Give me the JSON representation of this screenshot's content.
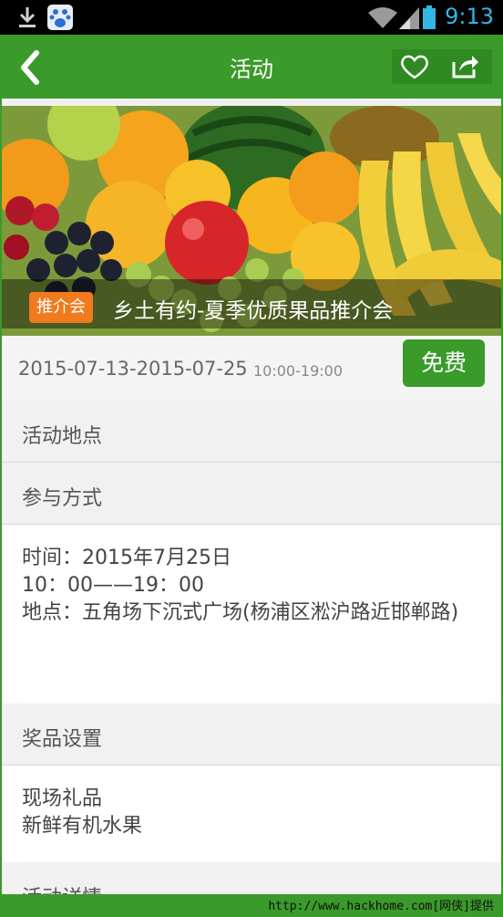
{
  "status_bar": {
    "time": "9:13",
    "icons": [
      "download-icon",
      "baidu-app-icon",
      "wifi-icon",
      "signal-icon",
      "battery-icon"
    ]
  },
  "nav": {
    "title": "活动",
    "icons": [
      "back-icon",
      "heart-icon",
      "share-icon"
    ]
  },
  "hero": {
    "tag": "推介会",
    "title": "乡土有约-夏季优质果品推介会"
  },
  "event": {
    "date_range": "2015-07-13-2015-07-25",
    "hours": "10:00-19:00",
    "price_button": "免费"
  },
  "sections": {
    "location": {
      "title": "活动地点"
    },
    "participation": {
      "title": "参与方式",
      "lines": [
        "时间：2015年7月25日",
        "10：00——19：00",
        "地点：五角场下沉式广场(杨浦区淞沪路近邯郸路)"
      ]
    },
    "prizes": {
      "title": "奖品设置",
      "lines": [
        "现场礼品",
        "新鲜有机水果"
      ]
    },
    "details": {
      "title": "活动详情"
    }
  },
  "watermark": "http://www.hackhome.com[网侠]提供",
  "colors": {
    "brand_green": "#3a9a2a",
    "tag_orange": "#f07a1c",
    "status_blue": "#33b5e5"
  }
}
